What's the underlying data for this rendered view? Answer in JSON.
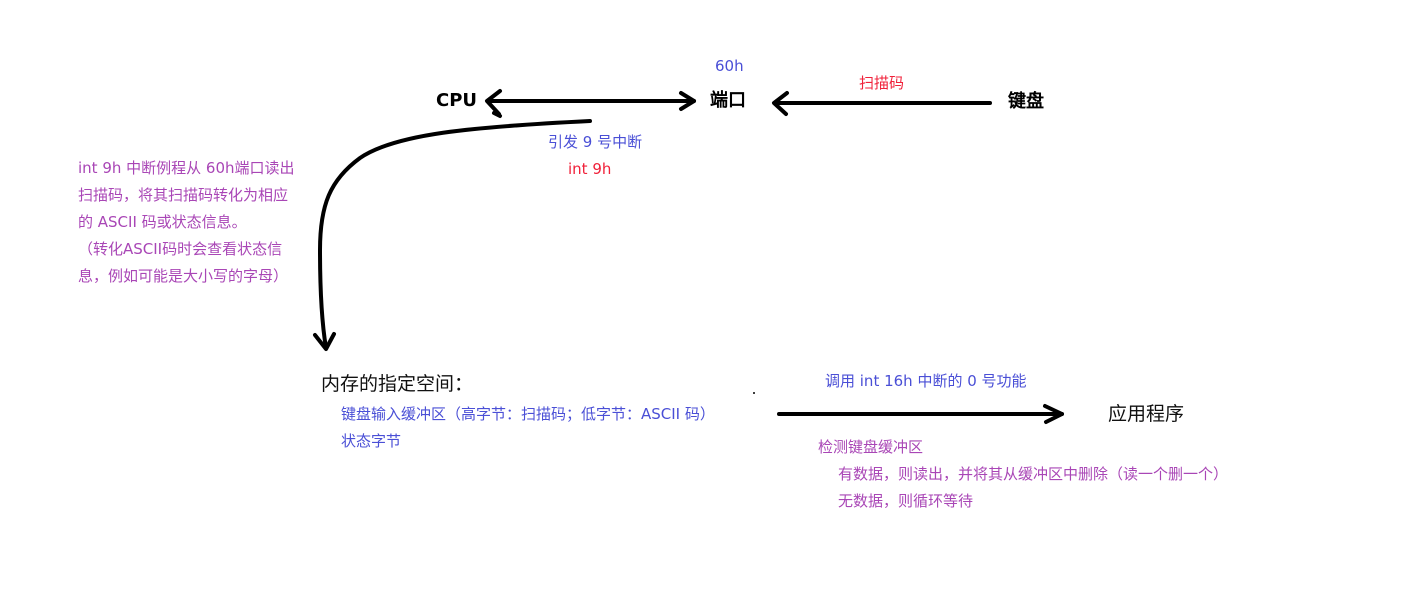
{
  "nodes": {
    "cpu": "CPU",
    "port": "端口",
    "keyboard": "键盘",
    "memory": "内存的指定空间：",
    "app": "应用程序"
  },
  "labels": {
    "port_number": "60h",
    "scan_code": "扫描码",
    "trigger_interrupt": "引发 9 号中断",
    "int9": "int 9h",
    "int16_call": "调用 int 16h 中断的 0 号功能"
  },
  "int9_description": [
    "int 9h 中断例程从 60h端口读出",
    "扫描码，将其扫描码转化为相应",
    "的 ASCII 码或状态信息。",
    "（转化ASCII码时会查看状态信",
    "息，例如可能是大小写的字母）"
  ],
  "memory_items": [
    "键盘输入缓冲区（高字节：扫描码；低字节：ASCII 码）",
    "状态字节"
  ],
  "int16_description": {
    "title": "检测键盘缓冲区",
    "items": [
      "有数据，则读出，并将其从缓冲区中删除（读一个删一个）",
      "无数据，则循环等待"
    ]
  },
  "colors": {
    "blue": "#4a4fd6",
    "red": "#f0213a",
    "purple": "#a946b6",
    "black": "#000000"
  }
}
